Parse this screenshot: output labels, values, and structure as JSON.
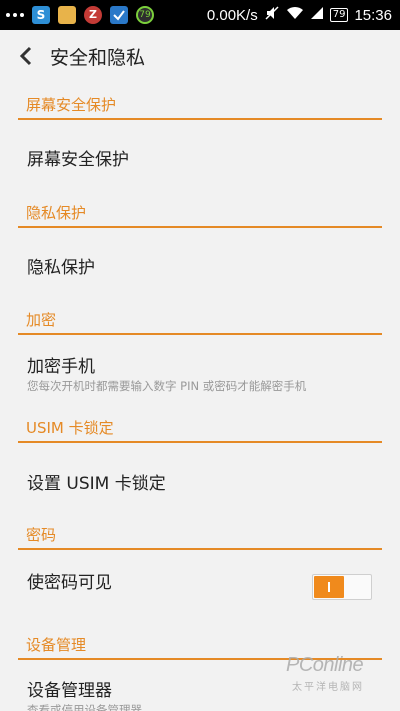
{
  "status_bar": {
    "speed": "0.00K/s",
    "battery": "79",
    "time": "15:36",
    "notification_badge": "79"
  },
  "header": {
    "title": "安全和隐私"
  },
  "sections": {
    "screen": {
      "header": "屏幕安全保护",
      "item_title": "屏幕安全保护"
    },
    "privacy": {
      "header": "隐私保护",
      "item_title": "隐私保护"
    },
    "encrypt": {
      "header": "加密",
      "item_title": "加密手机",
      "item_subtitle": "您每次开机时都需要输入数字 PIN 或密码才能解密手机"
    },
    "usim": {
      "header": "USIM 卡锁定",
      "item_title": "设置 USIM 卡锁定"
    },
    "password": {
      "header": "密码",
      "item_title": "使密码可见",
      "toggle_on": true
    },
    "device": {
      "header": "设备管理",
      "item_title": "设备管理器",
      "item_subtitle": "查看或停用设备管理器"
    }
  },
  "watermark": {
    "logo": "PConline",
    "sub": "太平洋电脑网"
  },
  "colors": {
    "accent": "#e58a26",
    "toggle_on": "#f08a1c",
    "background": "#f2f2f2"
  }
}
